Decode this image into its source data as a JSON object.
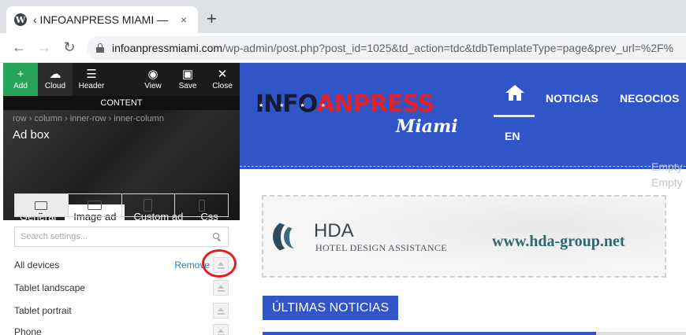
{
  "browser": {
    "tab_title": "‹ INFOANPRESS MIAMI —",
    "tab_close": "×",
    "new_tab": "+",
    "url_domain": "infoanpressmiami.com",
    "url_path": "/wp-admin/post.php?post_id=1025&td_action=tdc&tdbTemplateType=page&prev_url=%2F%",
    "back": "←",
    "forward": "→",
    "reload": "↻"
  },
  "toolbar": {
    "add": "Add",
    "cloud": "Cloud",
    "header": "Header",
    "view": "View",
    "save": "Save",
    "close": "Close"
  },
  "panel": {
    "content_label": "CONTENT",
    "breadcrumb": "row › column › inner-row › inner-column",
    "block_title": "Ad box",
    "tabs": [
      "General",
      "Image ad",
      "Custom ad",
      "Css"
    ],
    "active_tab": "Image ad",
    "search_placeholder": "Search settings...",
    "rows": [
      {
        "label": "All devices",
        "action": "Remove"
      },
      {
        "label": "Tablet landscape"
      },
      {
        "label": "Tablet portrait"
      },
      {
        "label": "Phone"
      }
    ]
  },
  "site": {
    "logo_main_1": "INFO",
    "logo_main_2": "ANPRESS",
    "logo_stars": "★ ★ ★ ★",
    "logo_sub": "Miami",
    "nav": [
      "NOTICIAS",
      "NEGOCIOS"
    ],
    "lang": "EN",
    "empty_1": "Empty",
    "empty_2": "Empty",
    "ad": {
      "brand": "HDA",
      "brand_sub": "HOTEL DESIGN ASSISTANCE",
      "url": "www.hda-group.net"
    },
    "section_label": "ÚLTIMAS NOTICIAS"
  },
  "colors": {
    "accent_blue": "#2f55c6",
    "add_green": "#27a35a",
    "annotation_red": "#e41b1b"
  }
}
